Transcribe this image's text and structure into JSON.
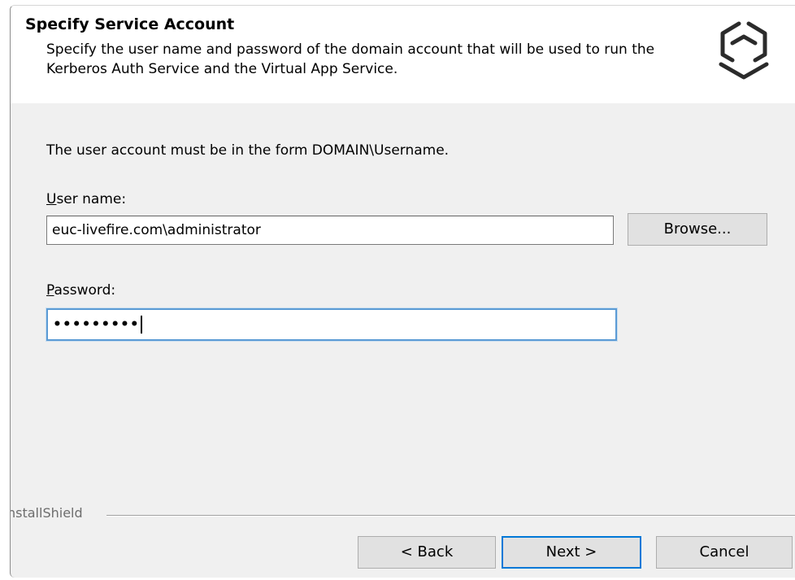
{
  "header": {
    "title": "Specify Service Account",
    "description": "Specify the user name and password of the domain account that will be used to run the Kerberos Auth Service and the Virtual App Service.",
    "logo_icon": "hexagon-logo-icon"
  },
  "body": {
    "instruction": "The user account must be in the form DOMAIN\\Username.",
    "username": {
      "label_mnemonic": "U",
      "label_rest": "ser name:",
      "value": "euc-livefire.com\\administrator"
    },
    "password": {
      "label_mnemonic": "P",
      "label_rest": "assword:",
      "masked_value": "•••••••••"
    },
    "browse_label": "Browse..."
  },
  "footer": {
    "brand": "nstallShield",
    "back_label": "< Back",
    "next_label": "Next >",
    "cancel_label": "Cancel"
  },
  "colors": {
    "dialog_bg": "#f0f0f0",
    "header_bg": "#ffffff",
    "focus_border": "#5b9bd5",
    "default_button_border": "#0078d7"
  }
}
